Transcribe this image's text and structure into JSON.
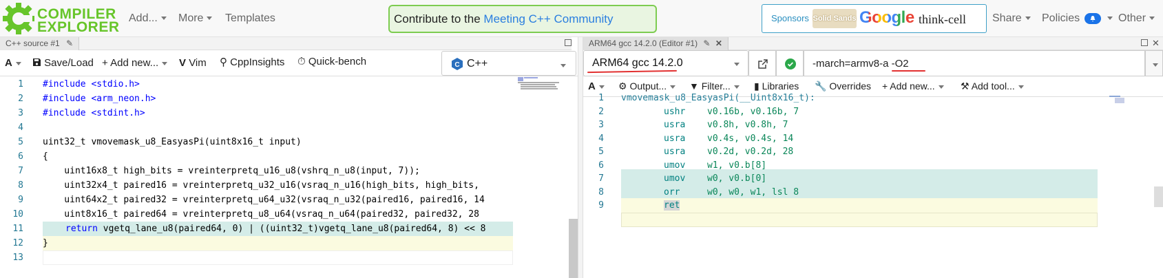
{
  "brand": {
    "line1": "COMPILER",
    "line2": "EXPLORER"
  },
  "nav": {
    "add": "Add...",
    "more": "More",
    "templates": "Templates",
    "share": "Share",
    "policies": "Policies",
    "other": "Other"
  },
  "survey": {
    "prefix": "Contribute to the ",
    "link": "Meeting C++ Community Survey",
    "suffix": ".",
    "close": "×"
  },
  "sponsors": {
    "label": "Sponsors",
    "s1": "Solid Sands",
    "s2": "Google",
    "s3": "think-cell"
  },
  "colors": {
    "green": "#67c52a",
    "blue": "#2a7ee0",
    "highlight_cyan": "#d4ece8",
    "highlight_yellow": "#fbfbe0"
  },
  "source": {
    "tab_title": "C++ source #1",
    "toolbar": {
      "font": "A",
      "save": "Save/Load",
      "add_new": "Add new...",
      "vim": "Vim",
      "cppinsights": "CppInsights",
      "quickbench": "Quick-bench",
      "language": "C++"
    },
    "lines": [
      {
        "n": "1",
        "text": ""
      },
      {
        "n": "2",
        "text": ""
      },
      {
        "n": "3",
        "text": ""
      },
      {
        "n": "4",
        "text": ""
      },
      {
        "n": "5",
        "text": "uint32_t vmovemask_u8_EasyasPi(uint8x16_t input)"
      },
      {
        "n": "6",
        "text": "{"
      },
      {
        "n": "7",
        "text": "    uint16x8_t high_bits = vreinterpretq_u16_u8(vshrq_n_u8(input, 7));"
      },
      {
        "n": "8",
        "text": "    uint32x4_t paired16 = vreinterpretq_u32_u16(vsraq_n_u16(high_bits, high_bits,"
      },
      {
        "n": "9",
        "text": "    uint64x2_t paired32 = vreinterpretq_u64_u32(vsraq_n_u32(paired16, paired16, 14"
      },
      {
        "n": "10",
        "text": "    uint8x16_t paired64 = vreinterpretq_u8_u64(vsraq_n_u64(paired32, paired32, 28"
      },
      {
        "n": "11",
        "text": ""
      },
      {
        "n": "12",
        "text": "}"
      },
      {
        "n": "13",
        "text": ""
      }
    ],
    "include1": "#include <stdio.h>",
    "include2": "#include <arm_neon.h>",
    "include3": "#include <stdint.h>",
    "line11_kw": "return",
    "line11_rest": " vgetq_lane_u8(paired64, 0) | ((uint32_t)vgetq_lane_u8(paired64, 8) << 8"
  },
  "asm": {
    "tab_title": "ARM64 gcc 14.2.0 (Editor #1)",
    "compiler": "ARM64 gcc 14.2.0",
    "options": "-march=armv8-a -O2",
    "toolbar": {
      "font": "A",
      "output": "Output...",
      "filter": "Filter...",
      "libraries": "Libraries",
      "overrides": "Overrides",
      "add_new": "Add new...",
      "add_tool": "Add tool..."
    },
    "label": "vmovemask_u8_EasyasPi(__Uint8x16_t):",
    "lines": [
      {
        "n": "1"
      },
      {
        "n": "2",
        "mn": "ushr",
        "ops": "v0.16b, v0.16b, 7"
      },
      {
        "n": "3",
        "mn": "usra",
        "ops": "v0.8h, v0.8h, 7"
      },
      {
        "n": "4",
        "mn": "usra",
        "ops": "v0.4s, v0.4s, 14"
      },
      {
        "n": "5",
        "mn": "usra",
        "ops": "v0.2d, v0.2d, 28"
      },
      {
        "n": "6",
        "mn": "umov",
        "ops": "w1, v0.b[8]"
      },
      {
        "n": "7",
        "mn": "umov",
        "ops": "w0, v0.b[0]"
      },
      {
        "n": "8",
        "mn": "orr",
        "ops": "w0, w0, w1, lsl 8"
      },
      {
        "n": "9",
        "mn": "ret",
        "ops": ""
      }
    ]
  }
}
